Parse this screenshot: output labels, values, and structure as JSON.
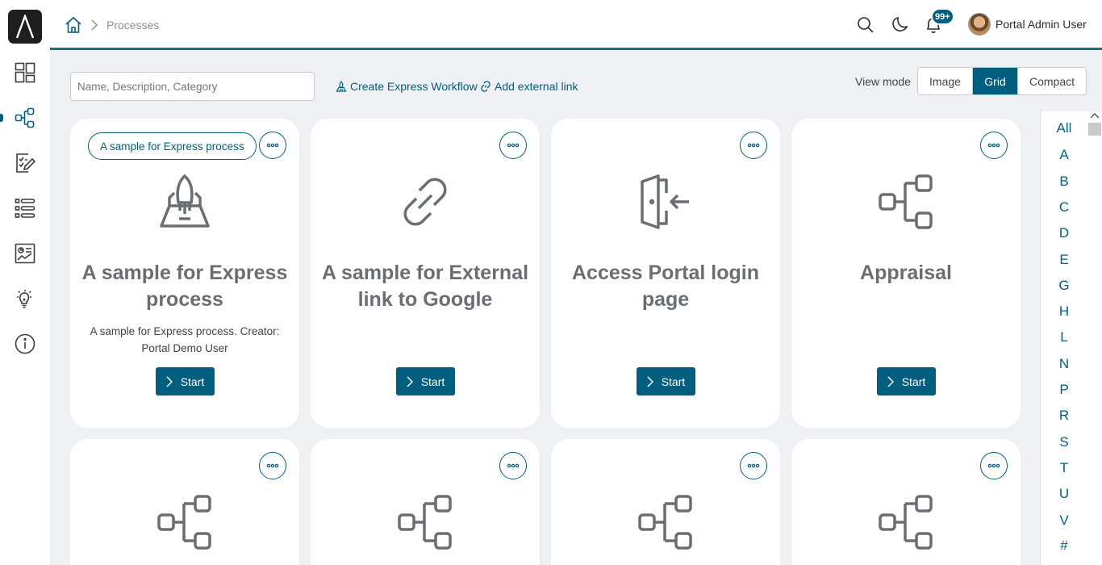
{
  "header": {
    "breadcrumb": {
      "current": "Processes"
    },
    "notifications_badge": "99+",
    "user_name": "Portal Admin User"
  },
  "toolbar": {
    "search_placeholder": "Name, Description, Category",
    "create_express_workflow": "Create Express Workflow",
    "add_external_link": "Add external link",
    "view_mode_label": "View mode",
    "view_modes": [
      "Image",
      "Grid",
      "Compact"
    ],
    "active_view_mode": "Grid"
  },
  "processes": [
    {
      "category": "A sample for Express process",
      "title": "A sample for Express process",
      "description": "A sample for Express process. Creator: Portal Demo User",
      "icon": "rocket-icon",
      "start_label": "Start"
    },
    {
      "category": "",
      "title": "A sample for External link to Google",
      "description": "",
      "icon": "link-icon",
      "start_label": "Start"
    },
    {
      "category": "",
      "title": "Access Portal login page",
      "description": "",
      "icon": "door-enter-icon",
      "start_label": "Start"
    },
    {
      "category": "",
      "title": "Appraisal",
      "description": "",
      "icon": "process-diagram-icon",
      "start_label": "Start"
    },
    {
      "icon": "process-diagram-icon"
    },
    {
      "icon": "process-diagram-icon"
    },
    {
      "icon": "process-diagram-icon"
    },
    {
      "icon": "process-diagram-icon"
    }
  ],
  "alphabet_index": [
    "All",
    "A",
    "B",
    "C",
    "D",
    "E",
    "G",
    "H",
    "L",
    "N",
    "P",
    "R",
    "S",
    "T",
    "U",
    "V",
    "#"
  ],
  "colors": {
    "primary": "#005f7f",
    "icon_gray": "#6a6e73",
    "background": "#eef0f3"
  }
}
